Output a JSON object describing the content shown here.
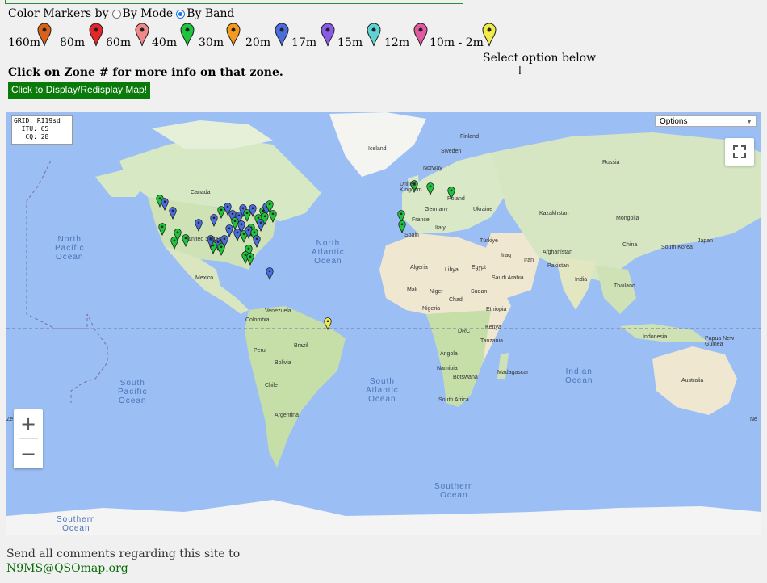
{
  "header": {
    "color_markers_label": "Color Markers by",
    "by_mode_label": "By Mode",
    "by_band_label": "By Band",
    "selected": "By Band"
  },
  "bands": [
    {
      "label": "160m",
      "color": "#d9621a"
    },
    {
      "label": "80m",
      "color": "#e8262a"
    },
    {
      "label": "60m",
      "color": "#f08a8a"
    },
    {
      "label": "40m",
      "color": "#1dc43c"
    },
    {
      "label": "30m",
      "color": "#f39a1f"
    },
    {
      "label": "20m",
      "color": "#4a6ee0"
    },
    {
      "label": "17m",
      "color": "#8a5be8"
    },
    {
      "label": "15m",
      "color": "#5fd3d3"
    },
    {
      "label": "12m",
      "color": "#e05aa0"
    },
    {
      "label": "10m - 2m",
      "color": "#f2ec4a"
    }
  ],
  "select_note": "Select option below",
  "select_arrow": "↓",
  "click_zone_text": "Click on Zone # for more info on that zone.",
  "display_button": "Click to Display/Redisplay Map!",
  "map": {
    "grid_info": "GRID: RI19sd\n  ITU: 65\n   CQ: 28",
    "options_label": "Options",
    "zoom_in": "+",
    "zoom_out": "−",
    "oceans": {
      "north_pacific": "North\nPacific\nOcean",
      "north_atlantic": "North\nAtlantic\nOcean",
      "south_pacific": "South\nPacific\nOcean",
      "south_atlantic": "South\nAtlantic\nOcean",
      "indian": "Indian\nOcean",
      "southern_1": "Southern\nOcean",
      "southern_2": "Southern\nOcean"
    },
    "places": {
      "finland": "Finland",
      "iceland": "Iceland",
      "sweden": "Sweden",
      "norway": "Norway",
      "russia": "Russia",
      "uk": "United\nKingdom",
      "poland": "Poland",
      "germany": "Germany",
      "ukraine": "Ukraine",
      "france": "France",
      "spain": "Spain",
      "italy": "Italy",
      "kazakhstan": "Kazakhstan",
      "mongolia": "Mongolia",
      "turkiye": "Türkiye",
      "china": "China",
      "japan": "Japan",
      "south_korea": "South Korea",
      "iraq": "Iraq",
      "iran": "Iran",
      "afghanistan": "Afghanistan",
      "pakistan": "Pakistan",
      "india": "India",
      "thailand": "Thailand",
      "canada": "Canada",
      "united_states": "United States",
      "mexico": "Mexico",
      "venezuela": "Venezuela",
      "colombia": "Colombia",
      "peru": "Peru",
      "brazil": "Brazil",
      "bolivia": "Bolivia",
      "chile": "Chile",
      "argentina": "Argentina",
      "algeria": "Algeria",
      "libya": "Libya",
      "egypt": "Egypt",
      "saudi_arabia": "Saudi Arabia",
      "mali": "Mali",
      "niger": "Niger",
      "chad": "Chad",
      "sudan": "Sudan",
      "nigeria": "Nigeria",
      "ethiopia": "Ethiopia",
      "drc": "DRC",
      "kenya": "Kenya",
      "tanzania": "Tanzania",
      "angola": "Angola",
      "namibia": "Namibia",
      "botswana": "Botswana",
      "madagascar": "Madagascar",
      "south_africa": "South Africa",
      "indonesia": "Indonesia",
      "papua_new_guinea": "Papua New\nGuinea",
      "australia": "Australia",
      "ze_left": "Ze",
      "ze_right": "Ne"
    }
  },
  "footer": {
    "text": "Send all comments regarding this site to",
    "email": "N9MS@QSOmap.org"
  }
}
